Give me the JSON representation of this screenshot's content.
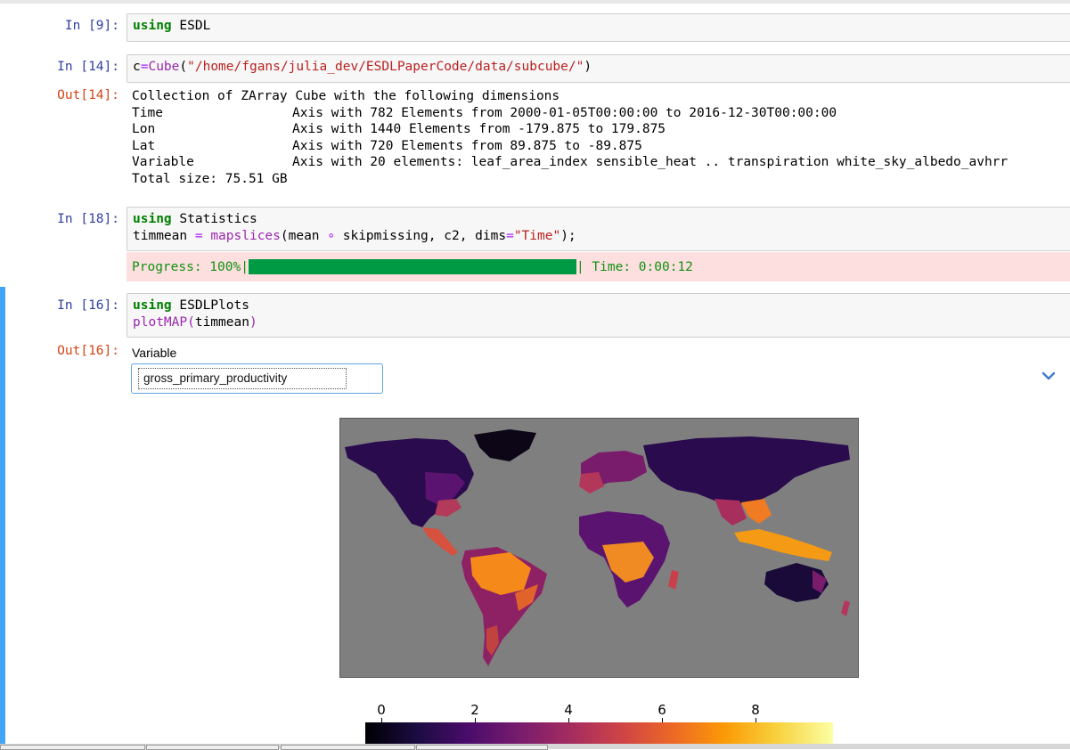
{
  "cells": {
    "c9": {
      "prompt": "In [9]:"
    },
    "c14": {
      "prompt": "In [14]:",
      "out_prompt": "Out[14]:"
    },
    "c18": {
      "prompt": "In [18]:"
    },
    "c16": {
      "prompt": "In [16]:",
      "out_prompt": "Out[16]:"
    }
  },
  "code9": {
    "kw": "using",
    "rest": " ESDL"
  },
  "code14": {
    "var": "c",
    "op": "=",
    "fn": "Cube",
    "paren_open": "(",
    "str": "\"/home/fgans/julia_dev/ESDLPaperCode/data/subcube/\"",
    "paren_close": ")"
  },
  "out14": {
    "header": "Collection of ZArray Cube with the following dimensions",
    "rows": [
      {
        "name": "Time",
        "desc": "Axis with 782 Elements from 2000-01-05T00:00:00 to 2016-12-30T00:00:00"
      },
      {
        "name": "Lon",
        "desc": "Axis with 1440 Elements from -179.875 to 179.875"
      },
      {
        "name": "Lat",
        "desc": "Axis with 720 Elements from 89.875 to -89.875"
      },
      {
        "name": "Variable",
        "desc": "Axis with 20 elements: leaf_area_index sensible_heat .. transpiration white_sky_albedo_avhrr"
      }
    ],
    "total": "Total size: 75.51 GB"
  },
  "code18": {
    "line1_kw": "using",
    "line1_rest": " Statistics",
    "line2_var": "timmean ",
    "line2_eq": "=",
    "line2_sp": " ",
    "line2_fn": "mapslices",
    "line2_a": "(mean ",
    "line2_op": "∘",
    "line2_b": " skipmissing, c2, dims",
    "line2_eq2": "=",
    "line2_str": "\"Time\"",
    "line2_end": ");"
  },
  "progress": {
    "label": "Progress: 100%|",
    "pipe": "|",
    "time": " Time: 0:00:12",
    "percent": 100,
    "color": "#009a44"
  },
  "code16": {
    "line1_kw": "using",
    "line1_rest": " ESDLPlots",
    "line2_fn": "plotMAP",
    "line2_paren": "(",
    "line2_arg": "timmean",
    "line2_close": ")"
  },
  "widget": {
    "label": "Variable",
    "selected": "gross_primary_productivity",
    "chevron_icon": "chevron-down-icon"
  },
  "colorbar": {
    "ticks": [
      {
        "label": "0",
        "value": 0
      },
      {
        "label": "2",
        "value": 2
      },
      {
        "label": "4",
        "value": 4
      },
      {
        "label": "6",
        "value": 6
      },
      {
        "label": "8",
        "value": 8
      }
    ],
    "max": 10,
    "colormap": "inferno"
  },
  "colors": {
    "prompt_in": "#303f9f",
    "prompt_out": "#d84315",
    "keyword": "#008000",
    "string": "#ba2121",
    "function": "#9c27b0",
    "selected_cell": "#42a5f5",
    "map_background": "#7f7f7f"
  }
}
